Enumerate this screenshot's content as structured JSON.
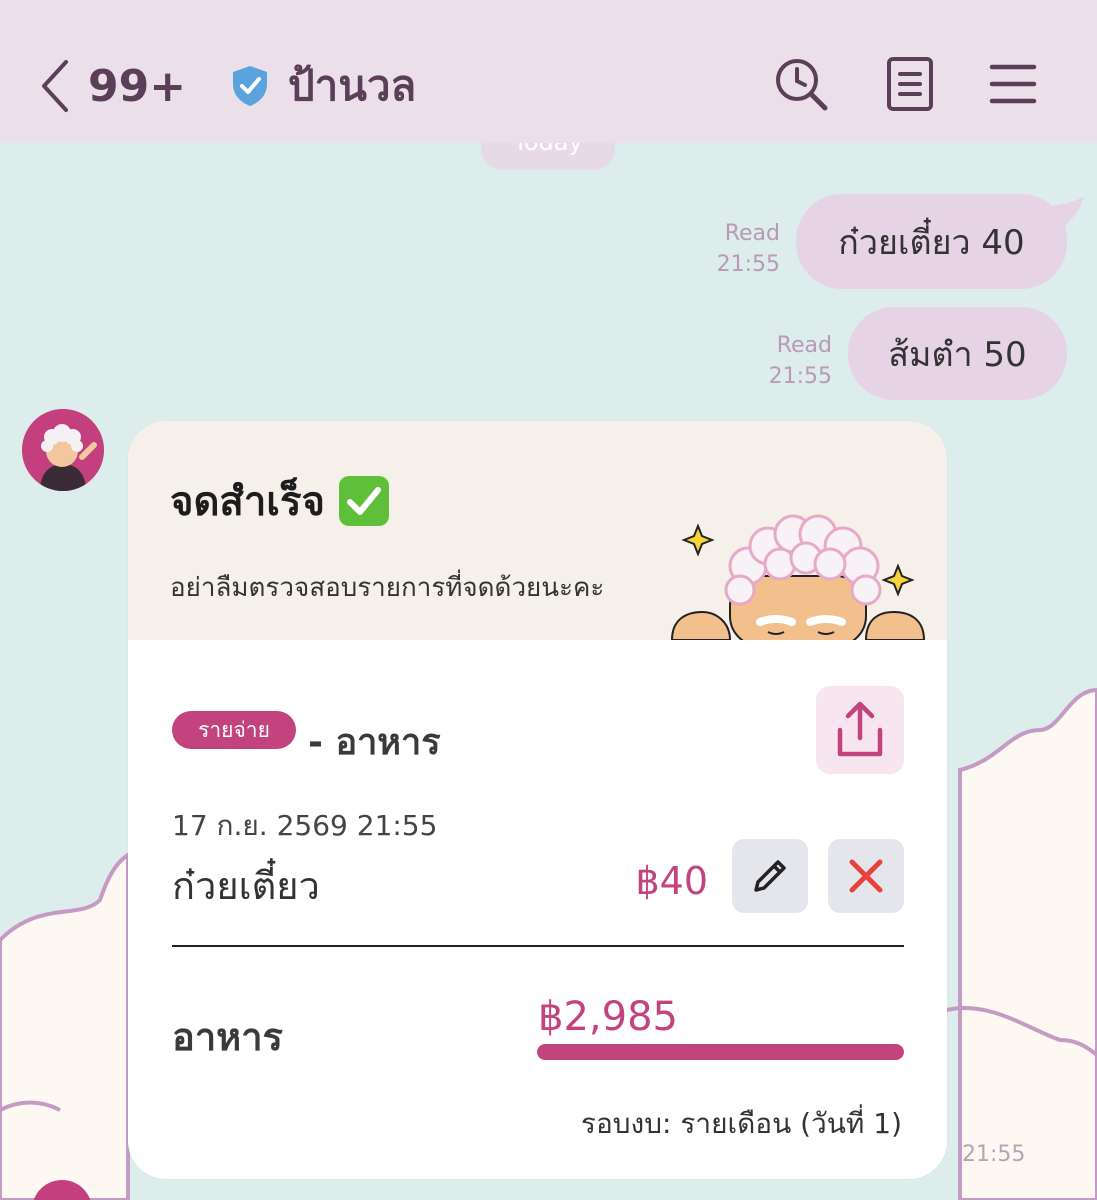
{
  "header": {
    "back_count": "99+",
    "title": "ป้านวล",
    "icons": [
      "back-chevron-icon",
      "verified-shield-icon",
      "search-history-icon",
      "notes-icon",
      "menu-icon"
    ]
  },
  "date_pill": "Today",
  "messages": [
    {
      "text": "ก๋วยเตี๋ยว 40",
      "status": "Read",
      "time": "21:55"
    },
    {
      "text": "ส้มตำ 50",
      "status": "Read",
      "time": "21:55"
    }
  ],
  "card": {
    "title": "จดสำเร็จ",
    "subtitle": "อย่าลืมตรวจสอบรายการที่จดด้วยนะคะ",
    "tag": "รายจ่าย",
    "category_title": "- อาหาร",
    "datetime": "17 ก.ย. 2569 21:55",
    "item_name": "ก๋วยเตี๋ยว",
    "item_price": "฿40",
    "budget_label": "อาหาร",
    "budget_amount": "฿2,985",
    "budget_progress": 1.0,
    "period": "รอบงบ: รายเดือน (วันที่ 1)",
    "time": "21:55"
  },
  "colors": {
    "header_bg": "#ebe0ea",
    "chat_bg": "#dcedec",
    "bubble": "#e6d3e6",
    "accent": "#c3437f",
    "header_text": "#5b3f58"
  }
}
